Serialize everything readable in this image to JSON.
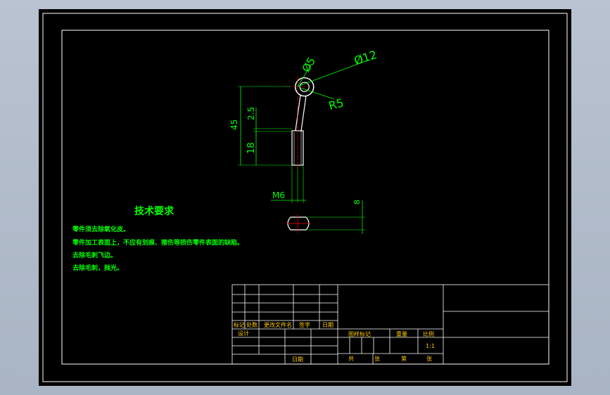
{
  "dimensions": {
    "dia_small": "Ø5",
    "dia_large": "Ø12",
    "radius": "R5",
    "total_length": "45",
    "neck_length": "2.5",
    "thread_length": "18",
    "thread": "M6",
    "section_width": "8"
  },
  "tech_requirements": {
    "title": "技术要求",
    "items": [
      "零件须去除氧化皮。",
      "零件加工表面上，不应有划痕、擦伤等损伤零件表面的缺陷。",
      "去除毛刺飞边。",
      "去除毛刺，抛光。"
    ]
  },
  "title_block": {
    "mark": "标记",
    "count": "处数",
    "change_doc": "更改文件名",
    "signature": "签字",
    "date": "日期",
    "design": "设计",
    "check_date": "日期",
    "stage_mark": "图样标记",
    "weight": "重量",
    "scale": "比例",
    "scale_value": "1:1",
    "total": "共",
    "sheets": "张",
    "sheet_no": "第",
    "sheet_unit": "张"
  },
  "colors": {
    "background": "#000000",
    "frame": "#ffffff",
    "dimension": "#00ff00",
    "part": "#ffffff",
    "centerline": "#ff0000",
    "title_block_text": "#ffcc00"
  }
}
